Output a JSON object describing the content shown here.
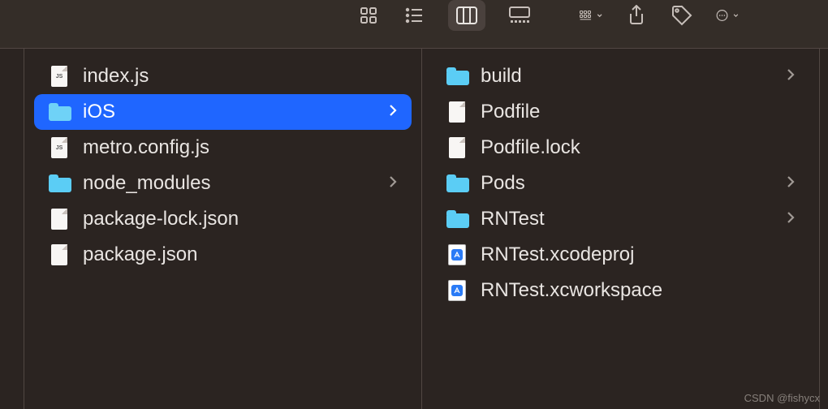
{
  "columns": [
    {
      "items": [
        {
          "name": "index.js",
          "type": "file",
          "tag": "JS",
          "selected": false,
          "hasChildren": false
        },
        {
          "name": "iOS",
          "type": "folder",
          "selected": true,
          "hasChildren": true
        },
        {
          "name": "metro.config.js",
          "type": "file",
          "tag": "JS",
          "selected": false,
          "hasChildren": false
        },
        {
          "name": "node_modules",
          "type": "folder",
          "selected": false,
          "hasChildren": true
        },
        {
          "name": "package-lock.json",
          "type": "file",
          "tag": "",
          "selected": false,
          "hasChildren": false
        },
        {
          "name": "package.json",
          "type": "file",
          "tag": "",
          "selected": false,
          "hasChildren": false
        }
      ]
    },
    {
      "items": [
        {
          "name": "build",
          "type": "folder",
          "selected": false,
          "hasChildren": true
        },
        {
          "name": "Podfile",
          "type": "file",
          "tag": "",
          "selected": false,
          "hasChildren": false
        },
        {
          "name": "Podfile.lock",
          "type": "file",
          "tag": "",
          "selected": false,
          "hasChildren": false
        },
        {
          "name": "Pods",
          "type": "folder",
          "selected": false,
          "hasChildren": true
        },
        {
          "name": "RNTest",
          "type": "folder",
          "selected": false,
          "hasChildren": true
        },
        {
          "name": "RNTest.xcodeproj",
          "type": "xcode",
          "selected": false,
          "hasChildren": false
        },
        {
          "name": "RNTest.xcworkspace",
          "type": "xcode",
          "selected": false,
          "hasChildren": false
        }
      ]
    }
  ],
  "watermark": "CSDN @fishycx"
}
